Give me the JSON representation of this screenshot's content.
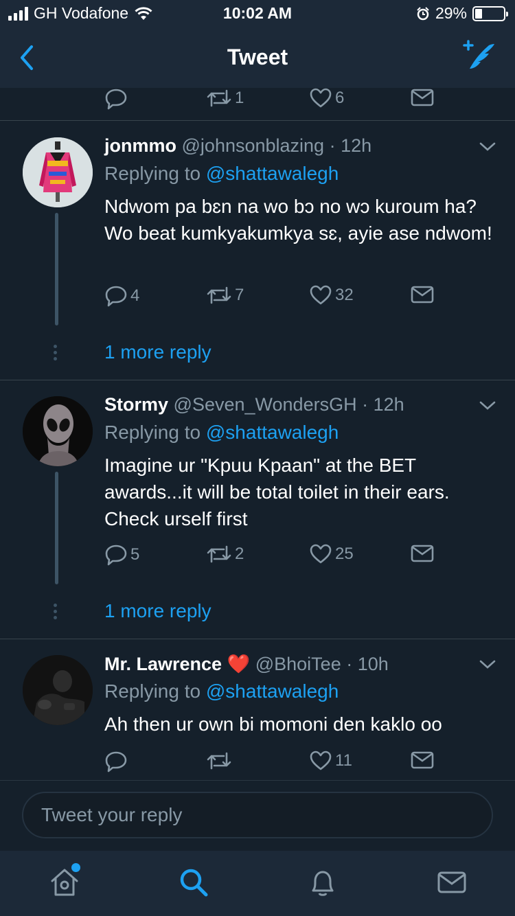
{
  "status_bar": {
    "carrier": "GH Vodafone",
    "time": "10:02 AM",
    "battery": "29%"
  },
  "nav": {
    "title": "Tweet"
  },
  "partial_tweet": {
    "retweets": "1",
    "likes": "6"
  },
  "tweets": [
    {
      "name": "jonmmo",
      "handle": "@johnsonblazing",
      "time": "12h",
      "replying_prefix": "Replying to",
      "mention": "@shattawalegh",
      "text": "Ndwom pa bɛn na wo bɔ no wɔ kuroum ha? Wo beat kumkyakumkya sɛ, ayie ase ndwom!",
      "replies": "4",
      "retweets": "7",
      "likes": "32",
      "more": "1 more reply"
    },
    {
      "name": "Stormy",
      "handle": "@Seven_WondersGH",
      "time": "12h",
      "replying_prefix": "Replying to",
      "mention": "@shattawalegh",
      "text": "Imagine ur \"Kpuu Kpaan\" at the BET awards...it will be total toilet in their ears. Check urself first",
      "replies": "5",
      "retweets": "2",
      "likes": "25",
      "more": "1 more reply"
    },
    {
      "name": "Mr. Lawrence",
      "emoji": "❤️",
      "handle": "@BhoiTee",
      "time": "10h",
      "replying_prefix": "Replying to",
      "mention": "@shattawalegh",
      "text": "Ah then ur own bi momoni den kaklo oo",
      "replies": "",
      "retweets": "",
      "likes": "11"
    }
  ],
  "reply_box": {
    "placeholder": "Tweet your reply"
  },
  "colors": {
    "background": "#15202b",
    "bar": "#1c2938",
    "accent": "#1da1f2",
    "muted": "#8899a6"
  },
  "icons": {
    "tabs": [
      "home-icon",
      "search-icon",
      "notifications-icon",
      "messages-icon"
    ]
  }
}
